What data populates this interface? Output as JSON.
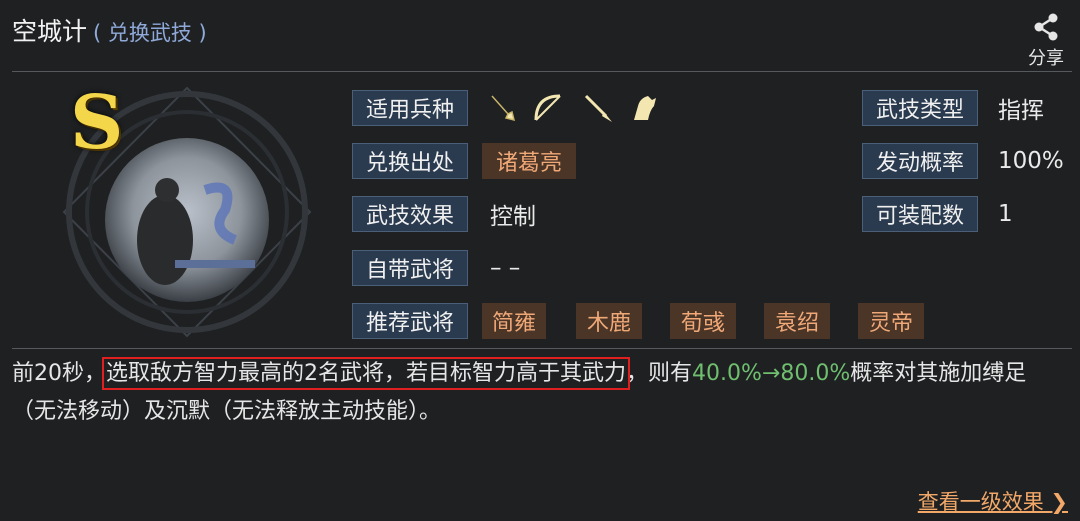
{
  "header": {
    "title": "空城计",
    "subtitle": "( 兑换武技 )",
    "share_label": "分享"
  },
  "skill": {
    "grade": "S",
    "labels": {
      "troops": "适用兵种",
      "source": "兑换出处",
      "effect": "武技效果",
      "general": "自带武将",
      "recommend": "推荐武将",
      "type": "武技类型",
      "rate": "发动概率",
      "equip": "可装配数"
    },
    "troop_icons": [
      "sword-icon",
      "bow-icon",
      "spear-icon",
      "horse-icon"
    ],
    "source_value": "诸葛亮",
    "effect_value": "控制",
    "general_value": "– –",
    "recommended": [
      "简雍",
      "木鹿",
      "荀彧",
      "袁绍",
      "灵帝"
    ],
    "type_value": "指挥",
    "rate_value": "100%",
    "equip_value": "1"
  },
  "description": {
    "prefix": "前20秒，",
    "highlight": "选取敌方智力最高的2名武将，若目标智力高于其武力",
    "middle": "，则有",
    "value": "40.0%→80.0%",
    "suffix": "概率对其施加缚足（无法移动）及沉默（无法释放主动技能）。"
  },
  "footer": {
    "more_label": "查看一级效果 ❯"
  },
  "colors": {
    "accent_tag": "#f0a877",
    "label_bg": "#2a3a4f",
    "value_green": "#6fbf6f",
    "highlight_border": "#e02020"
  }
}
